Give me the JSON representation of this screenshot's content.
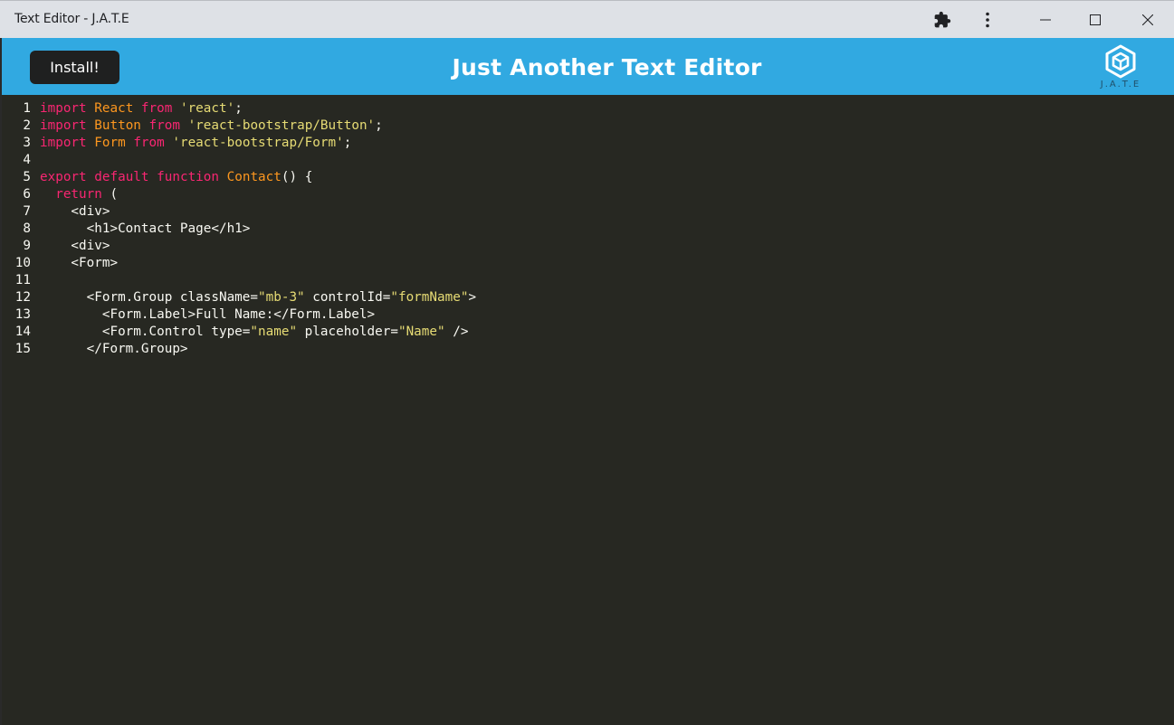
{
  "window": {
    "title": "Text Editor - J.A.T.E",
    "controls": [
      "extensions-icon",
      "more-icon",
      "minimize-icon",
      "maximize-icon",
      "close-icon"
    ]
  },
  "header": {
    "install_label": "Install!",
    "title": "Just Another Text Editor",
    "logo_text": "J.A.T.E",
    "background": "#31a9e1"
  },
  "editor": {
    "background": "#272822",
    "lines": [
      {
        "n": "1",
        "tokens": [
          [
            "kw",
            "import"
          ],
          [
            "tx",
            " "
          ],
          [
            "df",
            "React"
          ],
          [
            "tx",
            " "
          ],
          [
            "kw",
            "from"
          ],
          [
            "tx",
            " "
          ],
          [
            "st",
            "'react'"
          ],
          [
            "tx",
            ";"
          ]
        ]
      },
      {
        "n": "2",
        "tokens": [
          [
            "kw",
            "import"
          ],
          [
            "tx",
            " "
          ],
          [
            "df",
            "Button"
          ],
          [
            "tx",
            " "
          ],
          [
            "kw",
            "from"
          ],
          [
            "tx",
            " "
          ],
          [
            "st",
            "'react-bootstrap/Button'"
          ],
          [
            "tx",
            ";"
          ]
        ]
      },
      {
        "n": "3",
        "tokens": [
          [
            "kw",
            "import"
          ],
          [
            "tx",
            " "
          ],
          [
            "df",
            "Form"
          ],
          [
            "tx",
            " "
          ],
          [
            "kw",
            "from"
          ],
          [
            "tx",
            " "
          ],
          [
            "st",
            "'react-bootstrap/Form'"
          ],
          [
            "tx",
            ";"
          ]
        ]
      },
      {
        "n": "4",
        "tokens": []
      },
      {
        "n": "5",
        "tokens": [
          [
            "kw",
            "export"
          ],
          [
            "tx",
            " "
          ],
          [
            "kw",
            "default"
          ],
          [
            "tx",
            " "
          ],
          [
            "kw",
            "function"
          ],
          [
            "tx",
            " "
          ],
          [
            "df",
            "Contact"
          ],
          [
            "tx",
            "() {"
          ]
        ]
      },
      {
        "n": "6",
        "tokens": [
          [
            "tx",
            "  "
          ],
          [
            "kw",
            "return"
          ],
          [
            "tx",
            " ("
          ]
        ]
      },
      {
        "n": "7",
        "tokens": [
          [
            "tx",
            "    <div>"
          ]
        ]
      },
      {
        "n": "8",
        "tokens": [
          [
            "tx",
            "      <h1>Contact Page</h1>"
          ]
        ]
      },
      {
        "n": "9",
        "tokens": [
          [
            "tx",
            "    <div>"
          ]
        ]
      },
      {
        "n": "10",
        "tokens": [
          [
            "tx",
            "    <Form>"
          ]
        ]
      },
      {
        "n": "11",
        "tokens": []
      },
      {
        "n": "12",
        "tokens": [
          [
            "tx",
            "      <Form.Group className="
          ],
          [
            "st",
            "\"mb-3\""
          ],
          [
            "tx",
            " controlId="
          ],
          [
            "st",
            "\"formName\""
          ],
          [
            "tx",
            ">"
          ]
        ]
      },
      {
        "n": "13",
        "tokens": [
          [
            "tx",
            "        <Form.Label>Full Name:</Form.Label>"
          ]
        ]
      },
      {
        "n": "14",
        "tokens": [
          [
            "tx",
            "        <Form.Control type="
          ],
          [
            "st",
            "\"name\""
          ],
          [
            "tx",
            " placeholder="
          ],
          [
            "st",
            "\"Name\""
          ],
          [
            "tx",
            " />"
          ]
        ]
      },
      {
        "n": "15",
        "tokens": [
          [
            "tx",
            "      </Form.Group>"
          ]
        ]
      }
    ]
  }
}
